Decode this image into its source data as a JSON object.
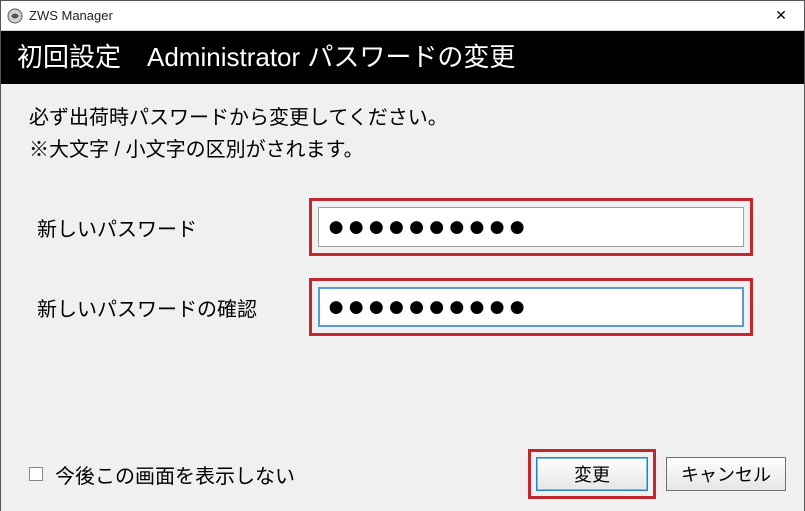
{
  "window": {
    "title": "ZWS Manager",
    "close_glyph": "✕"
  },
  "header": {
    "text": "初回設定　Administrator パスワードの変更"
  },
  "instructions": {
    "line1": "必ず出荷時パスワードから変更してください。",
    "line2": "※大文字 / 小文字の区別がされます。"
  },
  "fields": {
    "new_password": {
      "label": "新しいパスワード",
      "value": "●●●●●●●●●●"
    },
    "confirm_password": {
      "label": "新しいパスワードの確認",
      "value": "●●●●●●●●●●"
    }
  },
  "footer": {
    "checkbox_label": "今後この画面を表示しない",
    "checkbox_checked": false,
    "submit_label": "変更",
    "cancel_label": "キャンセル"
  },
  "colors": {
    "highlight_border": "#c1272d",
    "header_bg": "#000000",
    "content_bg": "#f0f0f0"
  }
}
